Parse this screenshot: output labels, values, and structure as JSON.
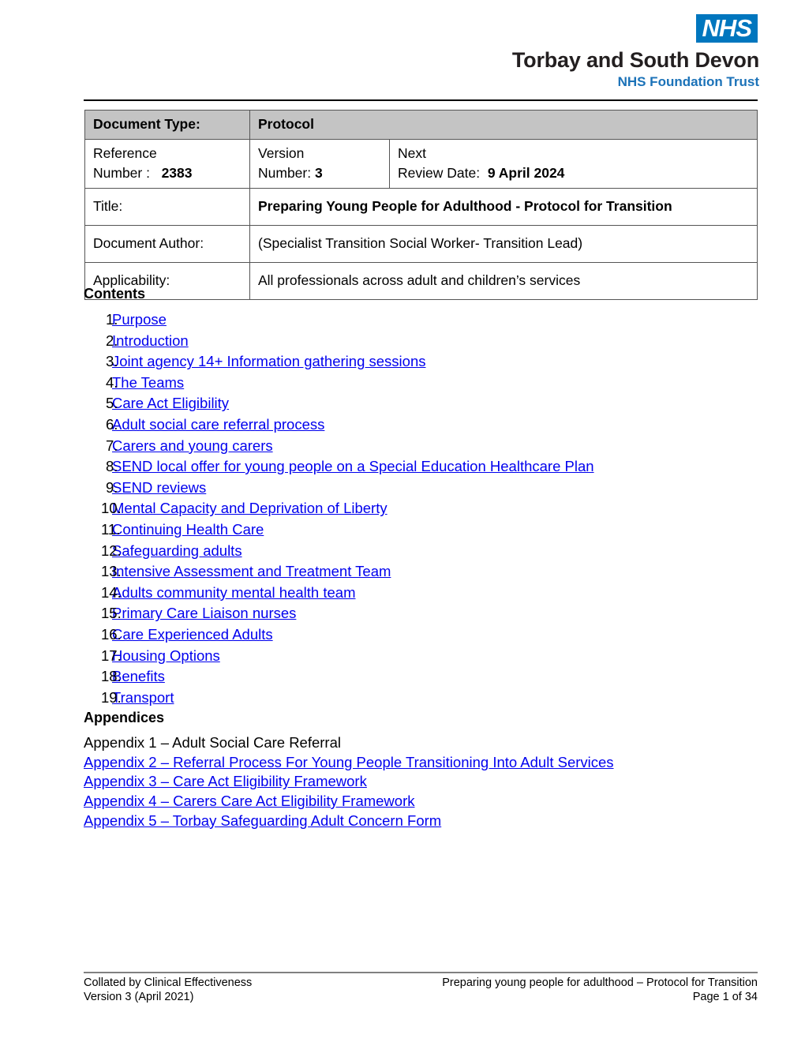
{
  "header": {
    "nhs_logo_text": "NHS",
    "trust_name": "Torbay and South Devon",
    "trust_subtitle": "NHS Foundation Trust",
    "nhs_blue": "#0076BE",
    "trust_sub_blue": "#1B72B8"
  },
  "info_table": {
    "doc_type_label": "Document Type:",
    "doc_type_value": "Protocol",
    "reference_label_line1": "Reference",
    "reference_label_line2": "Number :",
    "reference_value": "2383",
    "version_label_line1": "Version",
    "version_label_line2": "Number:",
    "version_value": "3",
    "next_review_label_line1": "Next",
    "next_review_label_line2": "Review Date:",
    "next_review_value": "9 April 2024",
    "title_label": "Title:",
    "title_value": "Preparing Young People for Adulthood - Protocol for Transition",
    "author_label": "Document Author:",
    "author_value": "(Specialist Transition Social Worker- Transition Lead)",
    "applicability_label": "Applicability:",
    "applicability_value": "All professionals across adult and children’s services",
    "header_shade_color": "#C4C4C4"
  },
  "contents": {
    "heading": "Contents",
    "link_color": "#0000EE",
    "items": [
      {
        "num": "1.",
        "label": "Purpose"
      },
      {
        "num": "2.",
        "label": "Introduction"
      },
      {
        "num": "3.",
        "label": "Joint agency 14+ Information gathering sessions"
      },
      {
        "num": "4.",
        "label": "The Teams"
      },
      {
        "num": "5.",
        "label": "Care Act Eligibility"
      },
      {
        "num": "6.",
        "label": "Adult social care referral process"
      },
      {
        "num": "7.",
        "label": "Carers and young carers"
      },
      {
        "num": "8.",
        "label": "SEND local offer for young people on a Special Education Healthcare Plan"
      },
      {
        "num": "9.",
        "label": "SEND reviews"
      },
      {
        "num": "10.",
        "label": "Mental Capacity and Deprivation of Liberty"
      },
      {
        "num": "11.",
        "label": "Continuing Health Care"
      },
      {
        "num": "12.",
        "label": "Safeguarding adults"
      },
      {
        "num": "13.",
        "label": "Intensive Assessment and Treatment Team"
      },
      {
        "num": "14.",
        "label": "Adults community mental health team"
      },
      {
        "num": "15.",
        "label": "Primary Care Liaison nurses"
      },
      {
        "num": "16.",
        "label": "Care Experienced Adults"
      },
      {
        "num": "17.",
        "label": "Housing Options"
      },
      {
        "num": "18.",
        "label": "Benefits"
      },
      {
        "num": "19.",
        "label": "Transport"
      }
    ]
  },
  "appendices": {
    "heading": "Appendices",
    "items": [
      {
        "text": "Appendix 1 – Adult Social Care Referral",
        "is_link": false
      },
      {
        "text": "Appendix 2 – Referral Process For Young People Transitioning Into Adult Services",
        "is_link": true
      },
      {
        "text": "Appendix 3 – Care Act Eligibility Framework",
        "is_link": true
      },
      {
        "text": "Appendix 4 – Carers Care Act Eligibility Framework",
        "is_link": true
      },
      {
        "text": "Appendix 5 – Torbay Safeguarding Adult Concern Form",
        "is_link": true
      }
    ]
  },
  "footer": {
    "left_line1": "Collated by Clinical Effectiveness",
    "left_line2": "Version 3 (April 2021)",
    "right_line1": "Preparing young people for adulthood – Protocol for Transition",
    "right_line2": "Page 1 of 34"
  }
}
